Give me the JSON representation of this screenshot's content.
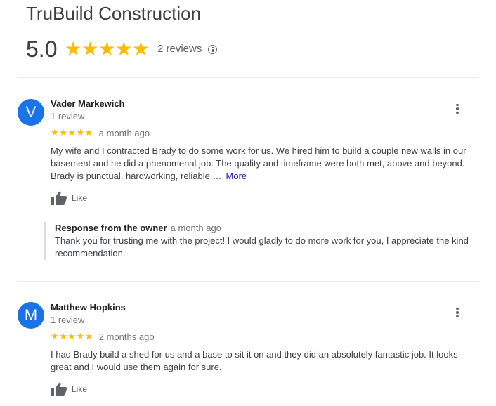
{
  "business": {
    "name": "TruBuild Construction",
    "rating": "5.0",
    "stars": "★★★★★",
    "review_count": "2 reviews"
  },
  "colors": {
    "avatar": "#1a73e8",
    "star": "#fbbc04",
    "link": "#1a0dab"
  },
  "reviews": [
    {
      "initial": "V",
      "name": "Vader Markewich",
      "reviewer_count": "1 review",
      "stars": "★★★★★",
      "date": "a month ago",
      "text": "My wife and I contracted Brady to do some work for us. We hired him to build a couple new walls in our basement and he did a phenomenal job. The quality and timeframe were both met, above and beyond. Brady is punctual, hardworking, reliable …",
      "more_label": "More",
      "like_label": "Like",
      "owner_response": {
        "label": "Response from the owner",
        "date": "a month ago",
        "text": "Thank you for trusting me with the project! I would gladly to do more work for you, I appreciate the kind recommendation."
      }
    },
    {
      "initial": "M",
      "name": "Matthew Hopkins",
      "reviewer_count": "1 review",
      "stars": "★★★★★",
      "date": "2 months ago",
      "text": "I had Brady build a shed for us and a base to sit it on and they did an absolutely fantastic job. It looks great and I would use them again for sure.",
      "like_label": "Like"
    }
  ]
}
